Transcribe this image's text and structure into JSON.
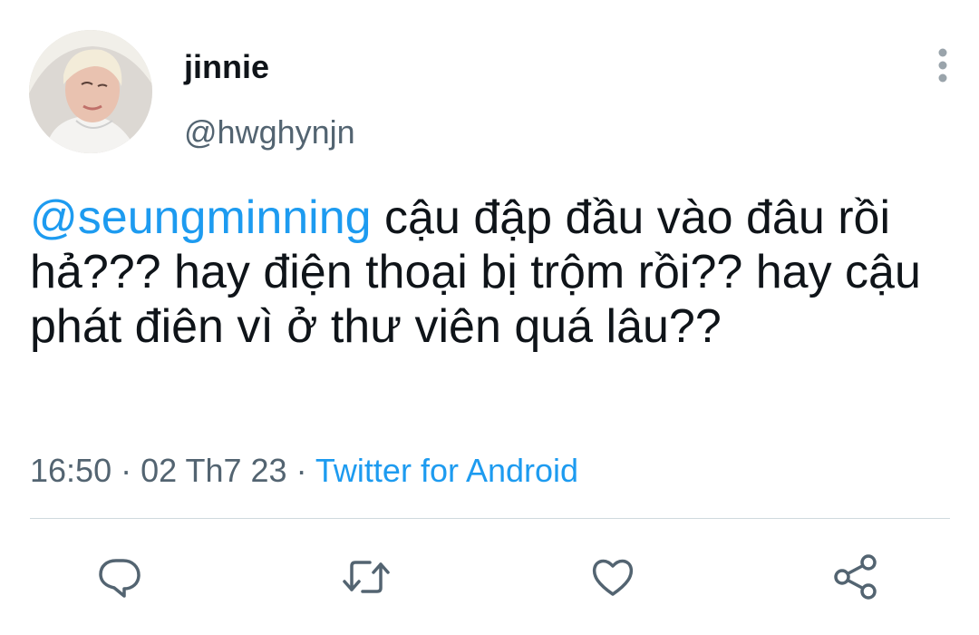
{
  "author": {
    "display_name": "jinnie",
    "handle": "@hwghynjn",
    "avatar_icon": "profile-photo"
  },
  "more_icon": "more-vertical-icon",
  "tweet": {
    "mention": "@seungminning",
    "text": " cậu đập đầu vào đâu rồi hả??? hay điện thoại bị trộm rồi?? hay cậu phát điên vì ở thư viên quá lâu??"
  },
  "meta": {
    "time": "16:50",
    "separator": " · ",
    "date": "02 Th7 23",
    "source": "Twitter for Android"
  },
  "actions": [
    {
      "name": "reply",
      "icon": "reply-bubble-icon"
    },
    {
      "name": "retweet",
      "icon": "retweet-icon"
    },
    {
      "name": "like",
      "icon": "heart-icon"
    },
    {
      "name": "share",
      "icon": "share-icon"
    }
  ],
  "colors": {
    "accent": "#1d9bf0",
    "secondary_text": "#536471",
    "primary_text": "#0f1419",
    "divider": "#cfd9de"
  }
}
